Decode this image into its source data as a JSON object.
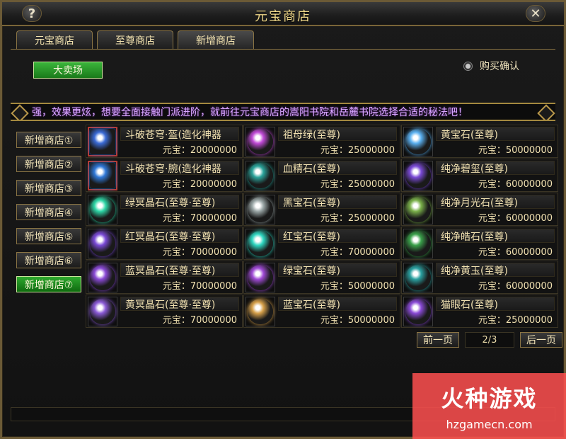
{
  "window": {
    "title": "元宝商店",
    "help_label": "?",
    "close_label": "✕"
  },
  "tabs": [
    {
      "label": "元宝商店"
    },
    {
      "label": "至尊商店"
    },
    {
      "label": "新增商店",
      "active": true
    }
  ],
  "toolbar": {
    "big_sale_label": "大卖场",
    "purchase_confirm_label": "购买确认"
  },
  "banner": {
    "text": "强，效果更炫，想要全面接触门派进阶，就前往元宝商店的嵩阳书院和岳麓书院选择合适的秘法吧！"
  },
  "side": [
    {
      "label": "新增商店①"
    },
    {
      "label": "新增商店②"
    },
    {
      "label": "新增商店③"
    },
    {
      "label": "新增商店④"
    },
    {
      "label": "新增商店⑤"
    },
    {
      "label": "新增商店⑥"
    },
    {
      "label": "新增商店⑦",
      "active": true
    }
  ],
  "items": [
    {
      "name": "斗破苍穹·盔(造化神器",
      "price": "元宝：20000000",
      "icon": "helmet-artifact-icon",
      "color": "#3b6bd6",
      "selected": true
    },
    {
      "name": "祖母绿(至尊)",
      "price": "元宝：25000000",
      "icon": "emerald-gem-icon",
      "color": "#c04ad6"
    },
    {
      "name": "黄宝石(至尊)",
      "price": "元宝：50000000",
      "icon": "yellow-gem-icon",
      "color": "#5ab0f0"
    },
    {
      "name": "斗破苍穹·腕(造化神器",
      "price": "元宝：20000000",
      "icon": "bracer-artifact-icon",
      "color": "#2f78d8",
      "selected": true
    },
    {
      "name": "血精石(至尊)",
      "price": "元宝：25000000",
      "icon": "blood-gem-icon",
      "color": "#2aa39a"
    },
    {
      "name": "纯净碧玺(至尊)",
      "price": "元宝：60000000",
      "icon": "tourmaline-gem-icon",
      "color": "#7a4ad6"
    },
    {
      "name": "绿冥晶石(至尊·至尊)",
      "price": "元宝：70000000",
      "icon": "green-crystal-icon",
      "color": "#2ed6a6"
    },
    {
      "name": "黑宝石(至尊)",
      "price": "元宝：25000000",
      "icon": "black-gem-icon",
      "color": "#9aa6a6"
    },
    {
      "name": "纯净月光石(至尊)",
      "price": "元宝：60000000",
      "icon": "moonstone-gem-icon",
      "color": "#7ab04a"
    },
    {
      "name": "红冥晶石(至尊·至尊)",
      "price": "元宝：70000000",
      "icon": "red-crystal-icon",
      "color": "#7a4ad6"
    },
    {
      "name": "红宝石(至尊)",
      "price": "元宝：70000000",
      "icon": "ruby-gem-icon",
      "color": "#2ed6c0"
    },
    {
      "name": "纯净皓石(至尊)",
      "price": "元宝：60000000",
      "icon": "pure-gem-icon",
      "color": "#3aa04a"
    },
    {
      "name": "蓝冥晶石(至尊·至尊)",
      "price": "元宝：70000000",
      "icon": "blue-crystal-icon",
      "color": "#8a4ad6"
    },
    {
      "name": "绿宝石(至尊)",
      "price": "元宝：50000000",
      "icon": "green-gem-icon",
      "color": "#a04ad6"
    },
    {
      "name": "纯净黄玉(至尊)",
      "price": "元宝：60000000",
      "icon": "topaz-gem-icon",
      "color": "#2aa0a0"
    },
    {
      "name": "黄冥晶石(至尊·至尊)",
      "price": "元宝：70000000",
      "icon": "yellow-crystal-icon",
      "color": "#8a5ad6"
    },
    {
      "name": "蓝宝石(至尊)",
      "price": "元宝：50000000",
      "icon": "sapphire-gem-icon",
      "color": "#d6a04a"
    },
    {
      "name": "猫眼石(至尊)",
      "price": "元宝：25000000",
      "icon": "cat-eye-gem-icon",
      "color": "#8a4ad6"
    }
  ],
  "pager": {
    "prev_label": "前一页",
    "page": "2/3",
    "next_label": "后一页"
  },
  "watermark": {
    "logo": "火种游戏",
    "url": "hzgamecn.com"
  }
}
